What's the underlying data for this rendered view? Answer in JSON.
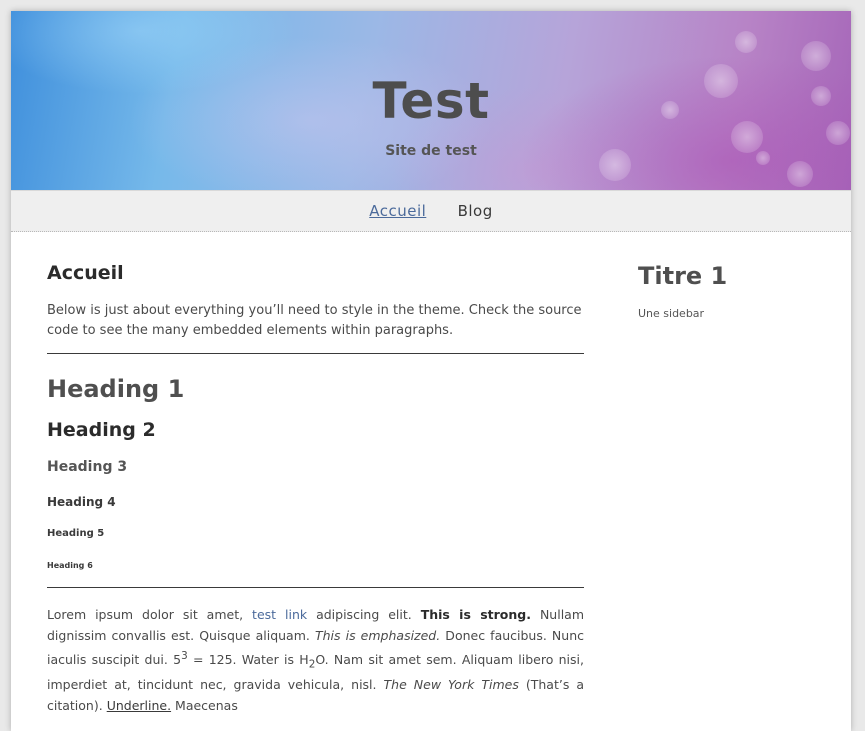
{
  "site": {
    "title": "Test",
    "description": "Site de test"
  },
  "nav": {
    "items": [
      {
        "label": "Accueil"
      },
      {
        "label": "Blog"
      }
    ]
  },
  "content": {
    "title": "Accueil",
    "intro": "Below is just about everything you’ll need to style in the theme. Check the source code to see the many embedded elements within paragraphs.",
    "headings": {
      "h1": "Heading 1",
      "h2": "Heading 2",
      "h3": "Heading 3",
      "h4": "Heading 4",
      "h5": "Heading 5",
      "h6": "Heading 6"
    },
    "paragraph": {
      "t1": "Lorem ipsum dolor sit amet, ",
      "link": "test link",
      "t2": " adipiscing elit. ",
      "strong": "This is strong.",
      "t3": " Nullam dignissim convallis est. Quisque aliquam. ",
      "em": "This is emphasized.",
      "t4": " Donec faucibus. Nunc iaculis suscipit dui. 5",
      "sup": "3",
      "t5": " = 125. Water is H",
      "sub": "2",
      "t6": "O. Nam sit amet sem. Aliquam libero nisi, imperdiet at, tincidunt nec, gravida vehicula, nisl. ",
      "cite": "The New York Times",
      "t7": " (That’s a citation). ",
      "underline": "Underline.",
      "t8": " Maecenas"
    }
  },
  "sidebar": {
    "title": "Titre 1",
    "text": "Une sidebar"
  },
  "colors": {
    "link": "#4b6a9b",
    "nav_bg": "#efefef",
    "text": "#505050"
  }
}
